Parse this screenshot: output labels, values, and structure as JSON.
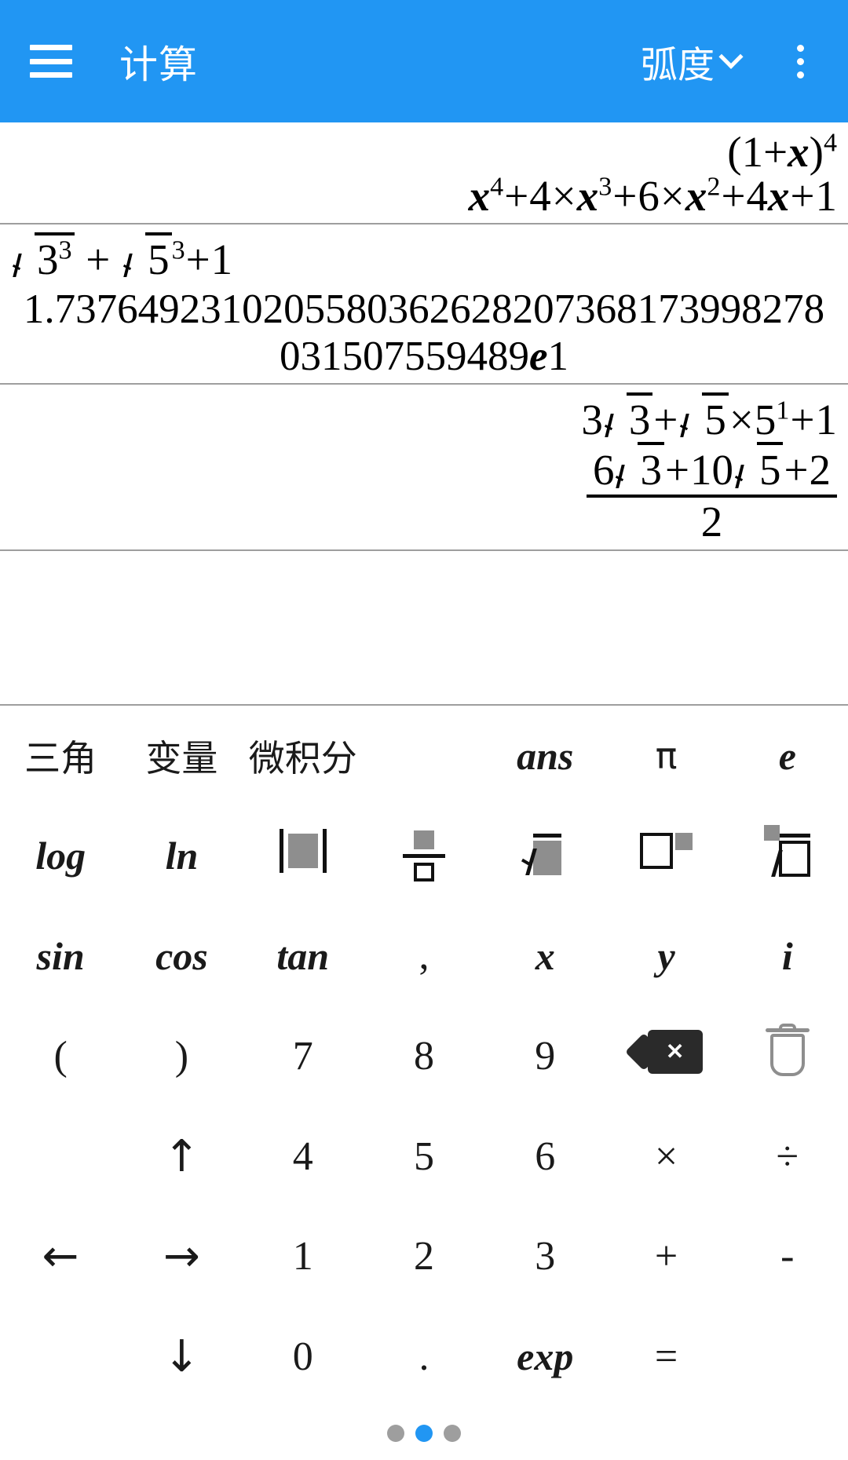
{
  "appbar": {
    "menu_icon": "hamburger-icon",
    "title": "计算",
    "angle_mode": "弧度",
    "chevron_icon": "chevron-down-icon",
    "overflow_icon": "more-vertical-icon",
    "background_color": "#2196f3",
    "text_color": "#ffffff"
  },
  "display": {
    "entries": [
      {
        "expression": "(1+x)^4",
        "expression_plain": "(1+x)⁴",
        "result": "x^4+4×x^3+6×x^2+4x+1",
        "result_plain": "x⁴+4×x³+6×x²+4x+1"
      },
      {
        "expression": "√(3^3)+√5^3+1",
        "expression_plain": "√3³ + √5³+1",
        "result_numeric": "1.7376492310205580362628207368173998278031507559489e1",
        "result_numeric_part1": "1.737649231020558036262820736",
        "result_numeric_part2": "8173998278031507559489",
        "result_numeric_exponent_mark": "e",
        "result_numeric_exponent": "1"
      },
      {
        "expression": "3√3+√5×5^1+1",
        "expression_plain": "3√3+√5×5¹+1",
        "result_numerator": "6√3+10√5+2",
        "result_denominator": "2"
      }
    ]
  },
  "keypad": {
    "rows": [
      [
        {
          "label": "三角",
          "name": "key-trig",
          "kind": "cjk"
        },
        {
          "label": "变量",
          "name": "key-variables",
          "kind": "cjk"
        },
        {
          "label": "微积分",
          "name": "key-calculus",
          "kind": "cjk"
        },
        {
          "label": "",
          "name": "key-spacer",
          "kind": "blank"
        },
        {
          "label": "ans",
          "name": "key-ans",
          "kind": "fn"
        },
        {
          "label": "π",
          "name": "key-pi",
          "kind": "pi"
        },
        {
          "label": "e",
          "name": "key-e",
          "kind": "fn"
        }
      ],
      [
        {
          "label": "log",
          "name": "key-log",
          "kind": "fn"
        },
        {
          "label": "ln",
          "name": "key-ln",
          "kind": "fn"
        },
        {
          "label": "|▮|",
          "name": "key-absolute-value",
          "kind": "glyph-abs"
        },
        {
          "label": "▪/▫",
          "name": "key-fraction",
          "kind": "glyph-frac"
        },
        {
          "label": "√▮",
          "name": "key-square-root",
          "kind": "glyph-sqrt"
        },
        {
          "label": "□^▪",
          "name": "key-power",
          "kind": "glyph-pow"
        },
        {
          "label": "▪√□",
          "name": "key-nth-root",
          "kind": "glyph-nroot"
        }
      ],
      [
        {
          "label": "sin",
          "name": "key-sin",
          "kind": "fn"
        },
        {
          "label": "cos",
          "name": "key-cos",
          "kind": "fn"
        },
        {
          "label": "tan",
          "name": "key-tan",
          "kind": "fn"
        },
        {
          "label": ",",
          "name": "key-comma",
          "kind": "sym"
        },
        {
          "label": "x",
          "name": "key-x",
          "kind": "fn"
        },
        {
          "label": "y",
          "name": "key-y",
          "kind": "fn"
        },
        {
          "label": "i",
          "name": "key-i",
          "kind": "fn"
        }
      ],
      [
        {
          "label": "(",
          "name": "key-left-paren",
          "kind": "sym"
        },
        {
          "label": ")",
          "name": "key-right-paren",
          "kind": "sym"
        },
        {
          "label": "7",
          "name": "key-7",
          "kind": "num"
        },
        {
          "label": "8",
          "name": "key-8",
          "kind": "num"
        },
        {
          "label": "9",
          "name": "key-9",
          "kind": "num"
        },
        {
          "label": "⌫",
          "name": "key-backspace",
          "kind": "glyph-del"
        },
        {
          "label": "🗑",
          "name": "key-clear-all",
          "kind": "glyph-trash"
        }
      ],
      [
        {
          "label": "",
          "name": "key-spacer-2",
          "kind": "blank"
        },
        {
          "label": "↑",
          "name": "key-arrow-up",
          "kind": "arrow"
        },
        {
          "label": "4",
          "name": "key-4",
          "kind": "num"
        },
        {
          "label": "5",
          "name": "key-5",
          "kind": "num"
        },
        {
          "label": "6",
          "name": "key-6",
          "kind": "num"
        },
        {
          "label": "×",
          "name": "key-multiply",
          "kind": "sym"
        },
        {
          "label": "÷",
          "name": "key-divide",
          "kind": "sym"
        }
      ],
      [
        {
          "label": "←",
          "name": "key-arrow-left",
          "kind": "arrow"
        },
        {
          "label": "→",
          "name": "key-arrow-right",
          "kind": "arrow"
        },
        {
          "label": "1",
          "name": "key-1",
          "kind": "num"
        },
        {
          "label": "2",
          "name": "key-2",
          "kind": "num"
        },
        {
          "label": "3",
          "name": "key-3",
          "kind": "num"
        },
        {
          "label": "+",
          "name": "key-plus",
          "kind": "sym"
        },
        {
          "label": "-",
          "name": "key-minus",
          "kind": "sym"
        }
      ],
      [
        {
          "label": "",
          "name": "key-spacer-3",
          "kind": "blank"
        },
        {
          "label": "↓",
          "name": "key-arrow-down",
          "kind": "arrow"
        },
        {
          "label": "0",
          "name": "key-0",
          "kind": "num"
        },
        {
          "label": ".",
          "name": "key-decimal-point",
          "kind": "sym"
        },
        {
          "label": "exp",
          "name": "key-exp",
          "kind": "fn"
        },
        {
          "label": "=",
          "name": "key-equals",
          "kind": "sym"
        },
        {
          "label": "",
          "name": "key-spacer-4",
          "kind": "blank"
        }
      ]
    ]
  },
  "pager": {
    "total": 3,
    "active_index": 1,
    "active_color": "#2196f3",
    "inactive_color": "#9e9e9e"
  }
}
